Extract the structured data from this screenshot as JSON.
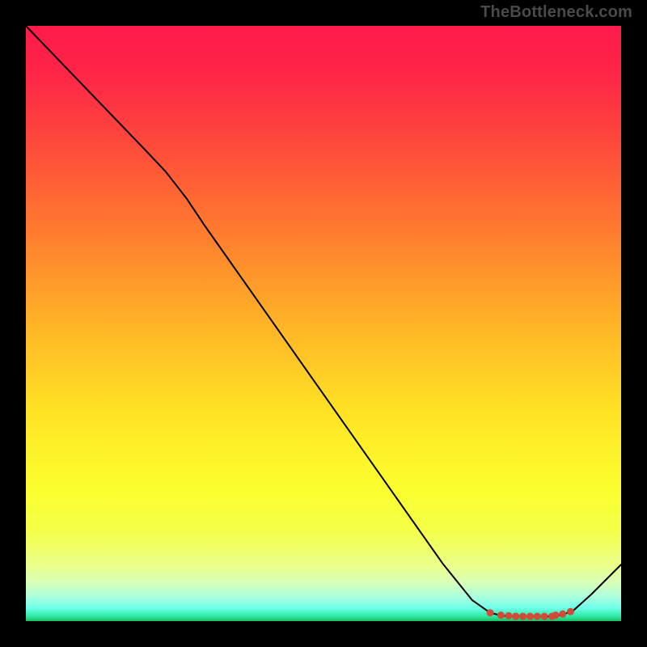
{
  "branding": {
    "watermark": "TheBottleneck.com"
  },
  "chart_data": {
    "type": "line",
    "title": "",
    "xlabel": "",
    "ylabel": "",
    "xlim": [
      0,
      100
    ],
    "ylim": [
      0,
      100
    ],
    "grid": false,
    "legend": false,
    "background_gradient": {
      "stops": [
        {
          "offset": 0.0,
          "color": "#ff1a4b"
        },
        {
          "offset": 0.08,
          "color": "#ff2547"
        },
        {
          "offset": 0.2,
          "color": "#ff4a3b"
        },
        {
          "offset": 0.35,
          "color": "#ff7d2e"
        },
        {
          "offset": 0.5,
          "color": "#ffb327"
        },
        {
          "offset": 0.65,
          "color": "#ffe324"
        },
        {
          "offset": 0.78,
          "color": "#fbff2e"
        },
        {
          "offset": 0.85,
          "color": "#f3ff4a"
        },
        {
          "offset": 0.905,
          "color": "#ecff88"
        },
        {
          "offset": 0.935,
          "color": "#d8ffb8"
        },
        {
          "offset": 0.96,
          "color": "#a8ffe0"
        },
        {
          "offset": 0.978,
          "color": "#6effe8"
        },
        {
          "offset": 0.992,
          "color": "#2de9a3"
        },
        {
          "offset": 1.0,
          "color": "#18c060"
        }
      ]
    },
    "series": [
      {
        "name": "curve",
        "stroke": "#000000",
        "stroke_width": 2,
        "x": [
          0.0,
          5.0,
          10.0,
          15.0,
          20.0,
          23.5,
          27.0,
          30.0,
          35.0,
          40.0,
          45.0,
          50.0,
          55.0,
          60.0,
          65.0,
          70.0,
          75.0,
          78.0,
          80.0,
          82.0,
          85.0,
          88.0,
          90.0,
          92.0,
          95.0,
          100.0
        ],
        "y": [
          100.0,
          94.8,
          89.6,
          84.4,
          79.2,
          75.5,
          71.0,
          66.5,
          59.4,
          52.3,
          45.2,
          38.1,
          31.0,
          23.9,
          16.8,
          9.7,
          3.5,
          1.4,
          0.9,
          0.8,
          0.8,
          0.8,
          1.0,
          1.8,
          4.5,
          9.5
        ]
      }
    ],
    "markers": {
      "name": "optimal-range-dots",
      "fill": "#d24a3a",
      "radius_px": 4.5,
      "x": [
        78.0,
        79.8,
        81.1,
        82.3,
        83.5,
        84.7,
        85.9,
        87.1,
        88.4,
        89.0,
        90.2,
        91.5
      ],
      "y": [
        1.4,
        1.0,
        0.9,
        0.8,
        0.8,
        0.8,
        0.8,
        0.8,
        0.8,
        1.0,
        1.2,
        1.6
      ]
    }
  }
}
